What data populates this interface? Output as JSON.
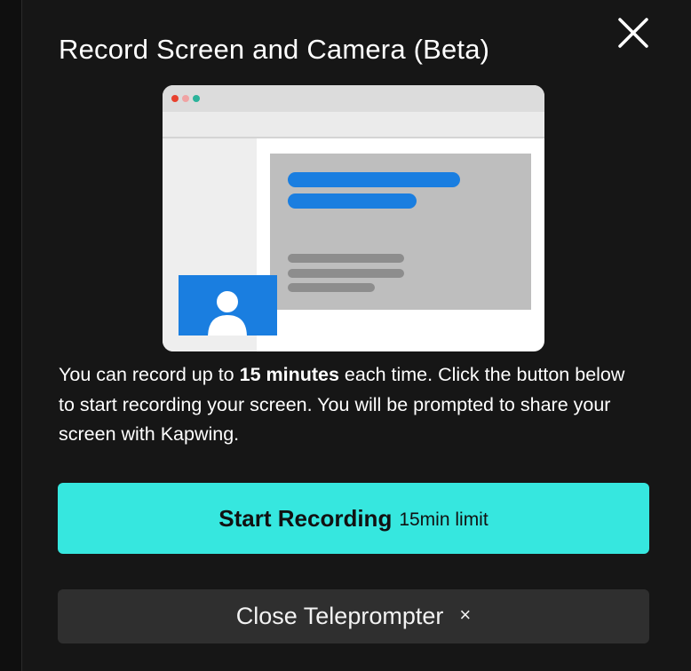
{
  "dialog": {
    "title": "Record Screen and Camera (Beta)",
    "description": {
      "prefix": "You can record up to ",
      "highlight": "15 minutes",
      "suffix": " each time. Click the button below to start recording your screen. You will be prompted to share your screen with Kapwing."
    },
    "start_button": {
      "label": "Start Recording",
      "sublabel": "15min limit"
    },
    "close_button": {
      "label": "Close Teleprompter",
      "icon_glyph": "×"
    }
  },
  "colors": {
    "background": "#161616",
    "accent_cyan": "#36e7df",
    "close_button_bg": "#2f2f2f",
    "illustration_blue": "#1a7ee0"
  },
  "icons": [
    "close-x-icon",
    "window-illustration",
    "person-icon"
  ]
}
